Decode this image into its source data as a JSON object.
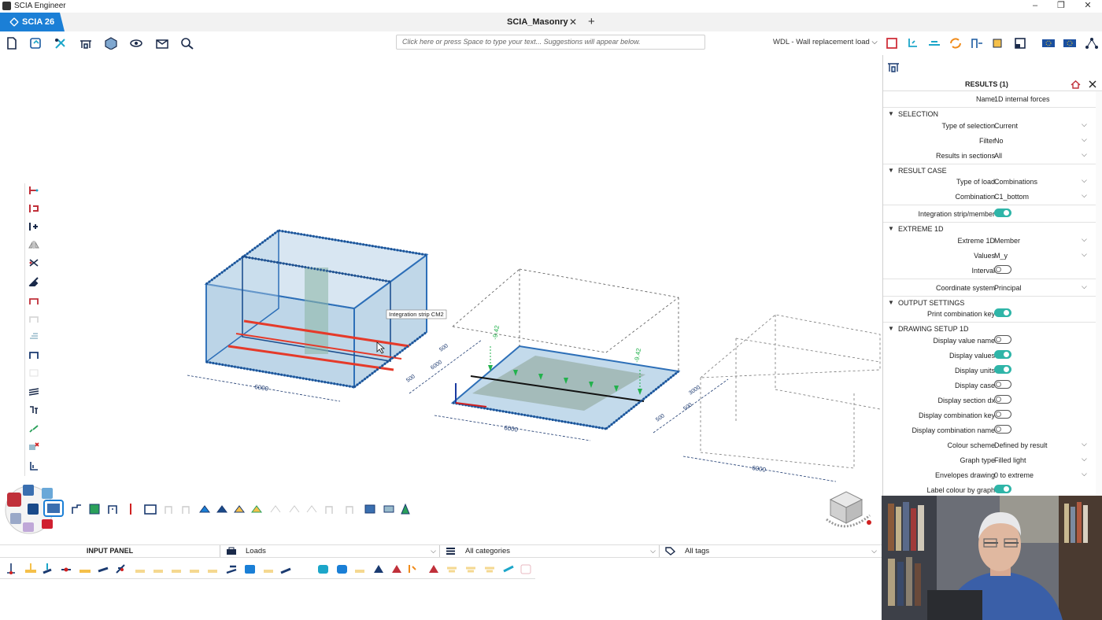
{
  "window": {
    "title": "SCIA Engineer",
    "minimize": "–",
    "maximize": "❐",
    "close": "✕"
  },
  "tabs": {
    "brand": "SCIA 26",
    "document": "SCIA_Masonry",
    "close": "✕",
    "add": "+"
  },
  "toolbar": {
    "command_placeholder": "Click here or press Space to type your text... Suggestions will appear below.",
    "active_command": "WDL - Wall replacement load",
    "chevron": "⌵"
  },
  "viewport": {
    "tooltip": "Integration strip CM2",
    "dim_left_long": "6000",
    "dim_left_short_a": "500",
    "dim_left_short_b": "6000",
    "dim_left_short_c": "500",
    "dim_mid_long": "6000",
    "dim_mid_short": "500",
    "dim_right_a": "3000",
    "dim_right_b": "500",
    "dim_right_long": "6000",
    "value_left": "-9.42",
    "value_right": "-9.42"
  },
  "results_panel": {
    "title": "RESULTS (1)",
    "name_label": "Name",
    "name_value": "1D internal forces",
    "sections": {
      "selection": "SELECTION",
      "result_case": "RESULT CASE",
      "extreme_1d": "EXTREME 1D",
      "output_settings": "OUTPUT SETTINGS",
      "drawing_setup": "DRAWING SETUP 1D"
    },
    "rows": {
      "type_of_selection": {
        "label": "Type of selection",
        "value": "Current"
      },
      "filter": {
        "label": "Filter",
        "value": "No"
      },
      "results_in_sections": {
        "label": "Results in sections",
        "value": "All"
      },
      "type_of_load": {
        "label": "Type of load",
        "value": "Combinations"
      },
      "combination": {
        "label": "Combination",
        "value": "C1_bottom"
      },
      "integration_strip": {
        "label": "Integration strip/member"
      },
      "extreme_1d": {
        "label": "Extreme 1D",
        "value": "Member"
      },
      "values": {
        "label": "Values",
        "value": "M_y"
      },
      "interval": {
        "label": "Interval"
      },
      "coordinate_system": {
        "label": "Coordinate system",
        "value": "Principal"
      },
      "print_combination_key": {
        "label": "Print combination key"
      },
      "display_value_name": {
        "label": "Display value name"
      },
      "display_values": {
        "label": "Display values"
      },
      "display_units": {
        "label": "Display units"
      },
      "display_case": {
        "label": "Display case"
      },
      "display_section_dx": {
        "label": "Display section dx"
      },
      "display_combination_key": {
        "label": "Display combination key"
      },
      "display_combination_name": {
        "label": "Display combination name"
      },
      "colour_scheme": {
        "label": "Colour scheme",
        "value": "Defined by result"
      },
      "graph_type": {
        "label": "Graph type",
        "value": "Filled light"
      },
      "envelopes_drawing": {
        "label": "Envelopes drawing",
        "value": "0 to extreme"
      },
      "label_colour_by_graph": {
        "label": "Label colour by graph"
      }
    },
    "toggles": {
      "integration_strip": true,
      "interval": false,
      "print_combination_key": true,
      "display_value_name": false,
      "display_values": true,
      "display_units": true,
      "display_case": false,
      "display_section_dx": false,
      "display_combination_key": false,
      "display_combination_name": false,
      "label_colour_by_graph": true
    }
  },
  "input_bar": {
    "title": "INPUT PANEL",
    "loads": "Loads",
    "categories": "All categories",
    "tags": "All tags"
  },
  "colors": {
    "brand": "#1b7fd6",
    "toggle_on": "#2fb5a8",
    "strip_red": "#e53a2a",
    "structure_blue": "#2d6fb8",
    "load_green": "#22b14c"
  },
  "icons": [
    "new-file-icon",
    "open-project-icon",
    "tools-icon",
    "structure-icon",
    "3d-view-icon",
    "eye-icon",
    "package-icon",
    "search-icon"
  ]
}
